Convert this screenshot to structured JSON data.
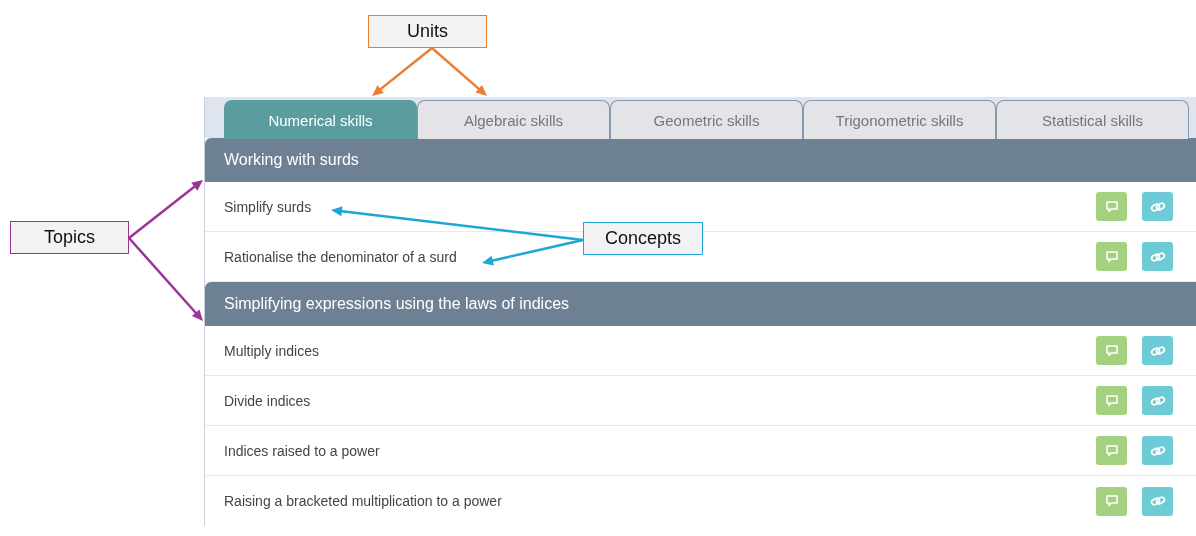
{
  "tabs": [
    {
      "label": "Numerical skills",
      "selected": true
    },
    {
      "label": "Algebraic skills",
      "selected": false
    },
    {
      "label": "Geometric skills",
      "selected": false
    },
    {
      "label": "Trigonometric skills",
      "selected": false
    },
    {
      "label": "Statistical skills",
      "selected": false
    }
  ],
  "topics": [
    {
      "title": "Working with surds",
      "concepts": [
        {
          "name": "Simplify surds"
        },
        {
          "name": "Rationalise the denominator of a surd"
        }
      ]
    },
    {
      "title": "Simplifying expressions using the laws of indices",
      "concepts": [
        {
          "name": "Multiply indices"
        },
        {
          "name": "Divide indices"
        },
        {
          "name": "Indices raised to a power"
        },
        {
          "name": "Raising a bracketed multiplication to a power"
        }
      ]
    }
  ],
  "callouts": [
    {
      "label": "Units",
      "color": "#ed7d31"
    },
    {
      "label": "Topics",
      "color": "#9b3399"
    },
    {
      "label": "Concepts",
      "color": "#1fa6d8"
    }
  ]
}
